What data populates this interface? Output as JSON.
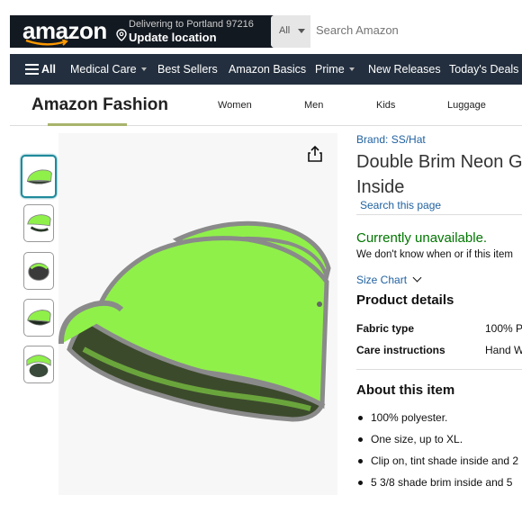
{
  "header": {
    "logo": "amazon",
    "deliver_line1": "Delivering to Portland 97216",
    "deliver_line2": "Update location",
    "search_category": "All",
    "search_placeholder": "Search Amazon"
  },
  "subnav": {
    "all": "All",
    "items": [
      "Medical Care",
      "Best Sellers",
      "Amazon Basics",
      "Prime",
      "New Releases",
      "Today's Deals"
    ]
  },
  "store": {
    "title": "Amazon Fashion",
    "links": [
      "Women",
      "Men",
      "Kids",
      "Luggage"
    ]
  },
  "product": {
    "brand": "Brand: SS/Hat",
    "title_line1": "Double Brim Neon G",
    "title_line2": "Inside",
    "search_page": "Search this page",
    "availability": "Currently unavailable.",
    "availability_note": "We don't know when or if this item",
    "size_chart": "Size Chart",
    "details_heading": "Product details",
    "details": [
      {
        "label": "Fabric type",
        "value": "100% P"
      },
      {
        "label": "Care instructions",
        "value": "Hand W"
      }
    ],
    "about_heading": "About this item",
    "bullets": [
      "100% polyester.",
      "One size, up to XL.",
      "Clip on, tint shade inside and 2",
      "5 3/8 shade brim inside and 5"
    ]
  },
  "colors": {
    "nav_dark": "#131921",
    "nav_secondary": "#232f3e",
    "link": "#2162a1",
    "in_stock_green": "#007600",
    "visor_green": "#8ff04a"
  }
}
